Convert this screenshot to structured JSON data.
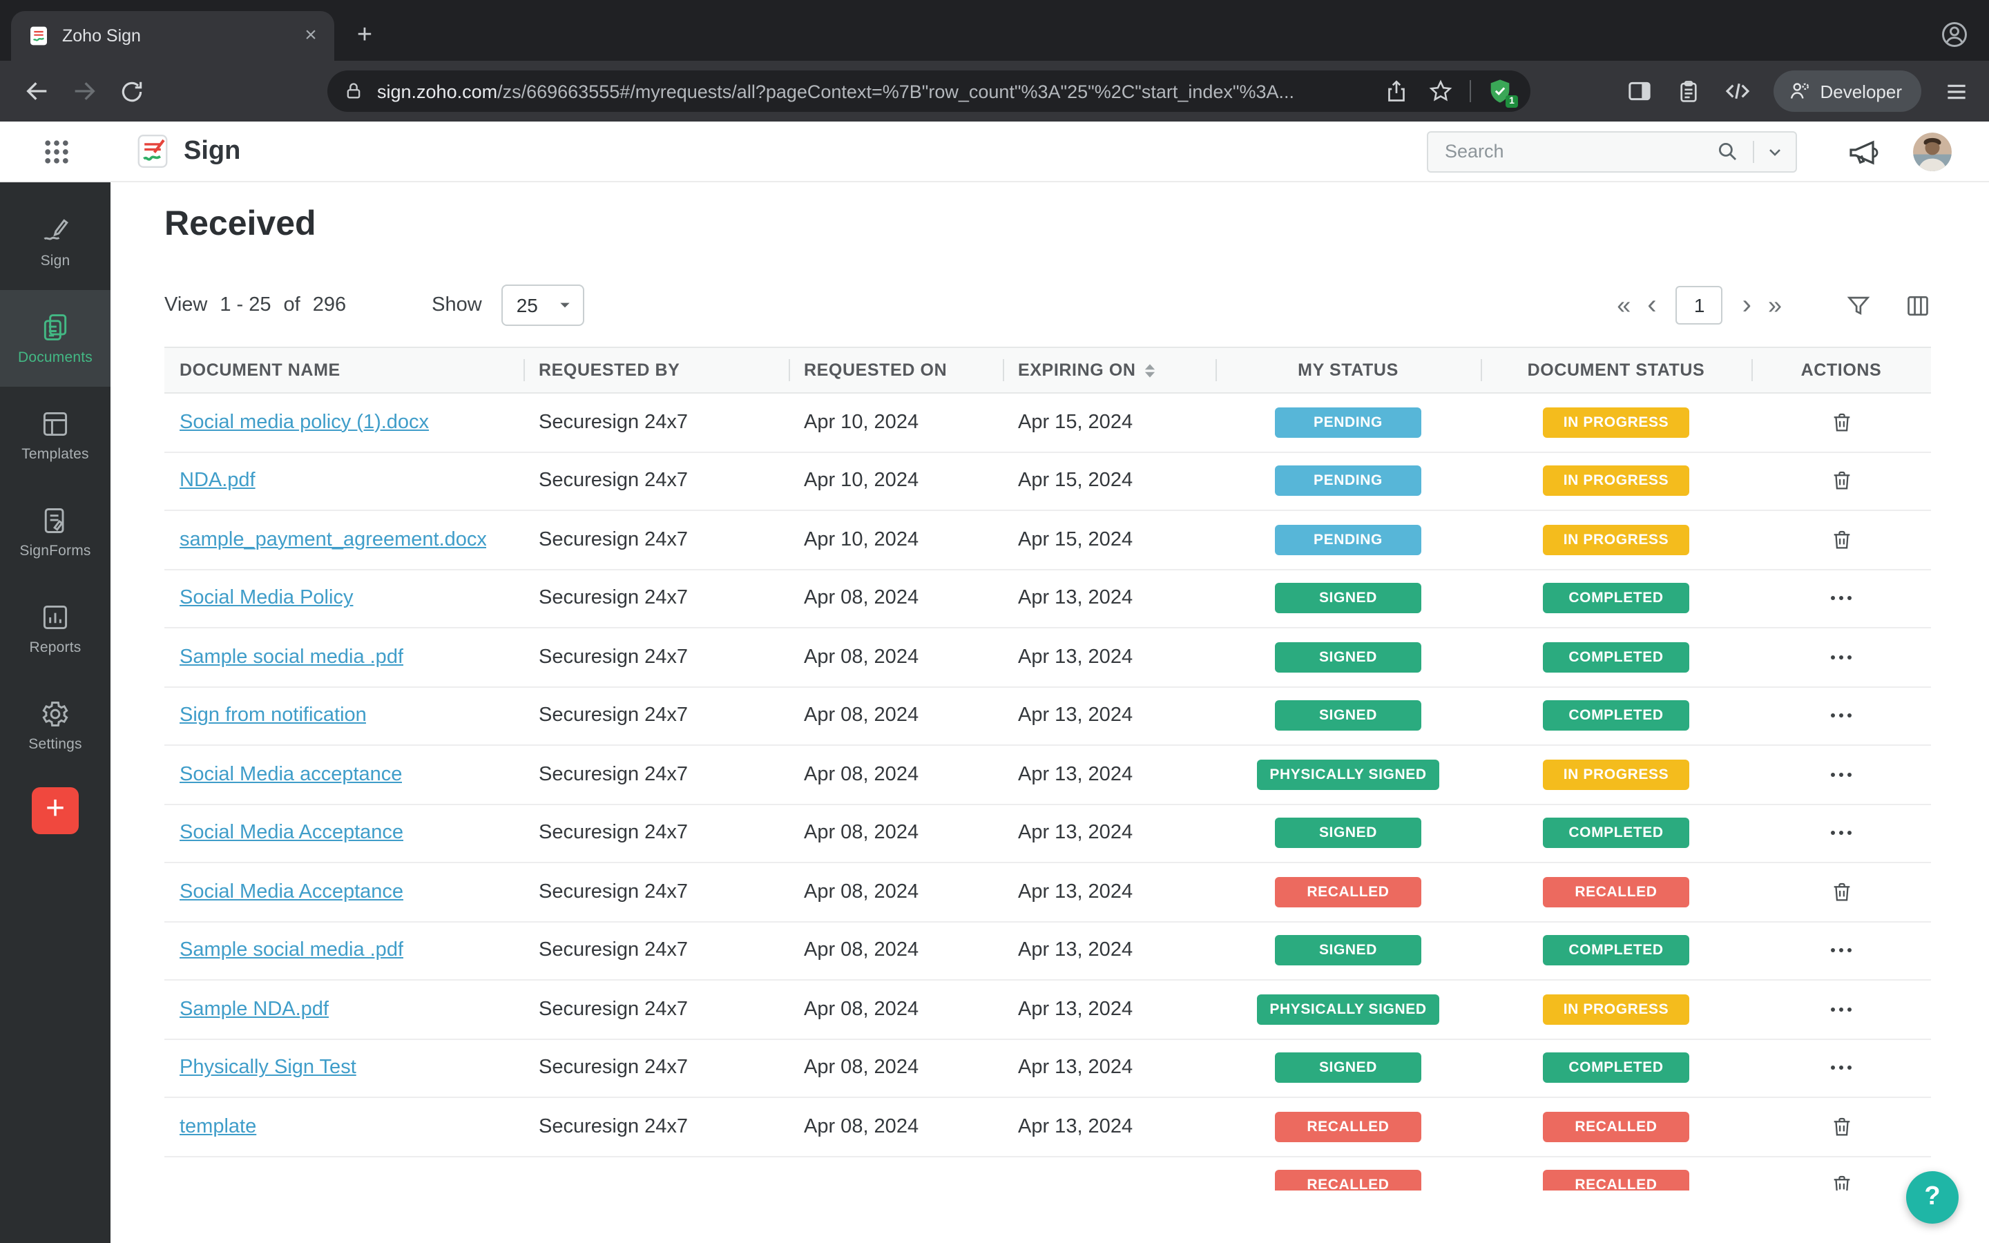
{
  "browser": {
    "tab_title": "Zoho Sign",
    "url_domain": "sign.zoho.com",
    "url_path": "/zs/669663555#/myrequests/all?pageContext=%7B\"row_count\"%3A\"25\"%2C\"start_index\"%3A...",
    "shield_count": "1",
    "developer_label": "Developer"
  },
  "icons": {
    "close": "×",
    "plus": "+",
    "help": "?",
    "pager_first": "«",
    "pager_prev": "‹",
    "pager_next": "›",
    "pager_last": "»"
  },
  "app_header": {
    "product_name": "Sign",
    "search_placeholder": "Search"
  },
  "sidebar": {
    "items": [
      {
        "label": "Sign"
      },
      {
        "label": "Documents"
      },
      {
        "label": "Templates"
      },
      {
        "label": "SignForms"
      },
      {
        "label": "Reports"
      },
      {
        "label": "Settings"
      }
    ]
  },
  "page": {
    "title": "Received",
    "view_label": "View",
    "view_range": "1 - 25",
    "view_of": "of",
    "view_total": "296",
    "show_label": "Show",
    "show_value": "25",
    "page_number": "1"
  },
  "table": {
    "columns": [
      "DOCUMENT NAME",
      "REQUESTED BY",
      "REQUESTED ON",
      "EXPIRING ON",
      "MY STATUS",
      "DOCUMENT STATUS",
      "ACTIONS"
    ],
    "status_colors": {
      "PENDING": "#57B6D8",
      "SIGNED": "#2BAB7F",
      "PHYSICALLY SIGNED": "#2BAB7F",
      "RECALLED": "#EC6A5F",
      "IN PROGRESS": "#F4BC1D",
      "COMPLETED": "#2BAB7F"
    },
    "rows": [
      {
        "name": "Social media policy (1).docx",
        "requested_by": "Securesign 24x7",
        "requested_on": "Apr 10, 2024",
        "expiring_on": "Apr 15, 2024",
        "my_status": "PENDING",
        "doc_status": "IN PROGRESS",
        "action": "trash"
      },
      {
        "name": "NDA.pdf",
        "requested_by": "Securesign 24x7",
        "requested_on": "Apr 10, 2024",
        "expiring_on": "Apr 15, 2024",
        "my_status": "PENDING",
        "doc_status": "IN PROGRESS",
        "action": "trash"
      },
      {
        "name": "sample_payment_agreement.docx",
        "requested_by": "Securesign 24x7",
        "requested_on": "Apr 10, 2024",
        "expiring_on": "Apr 15, 2024",
        "my_status": "PENDING",
        "doc_status": "IN PROGRESS",
        "action": "trash"
      },
      {
        "name": "Social Media Policy",
        "requested_by": "Securesign 24x7",
        "requested_on": "Apr 08, 2024",
        "expiring_on": "Apr 13, 2024",
        "my_status": "SIGNED",
        "doc_status": "COMPLETED",
        "action": "dots"
      },
      {
        "name": "Sample social media .pdf",
        "requested_by": "Securesign 24x7",
        "requested_on": "Apr 08, 2024",
        "expiring_on": "Apr 13, 2024",
        "my_status": "SIGNED",
        "doc_status": "COMPLETED",
        "action": "dots"
      },
      {
        "name": "Sign from notification",
        "requested_by": "Securesign 24x7",
        "requested_on": "Apr 08, 2024",
        "expiring_on": "Apr 13, 2024",
        "my_status": "SIGNED",
        "doc_status": "COMPLETED",
        "action": "dots"
      },
      {
        "name": "Social Media acceptance",
        "requested_by": "Securesign 24x7",
        "requested_on": "Apr 08, 2024",
        "expiring_on": "Apr 13, 2024",
        "my_status": "PHYSICALLY SIGNED",
        "doc_status": "IN PROGRESS",
        "action": "dots"
      },
      {
        "name": "Social Media Acceptance",
        "requested_by": "Securesign 24x7",
        "requested_on": "Apr 08, 2024",
        "expiring_on": "Apr 13, 2024",
        "my_status": "SIGNED",
        "doc_status": "COMPLETED",
        "action": "dots"
      },
      {
        "name": "Social Media Acceptance",
        "requested_by": "Securesign 24x7",
        "requested_on": "Apr 08, 2024",
        "expiring_on": "Apr 13, 2024",
        "my_status": "RECALLED",
        "doc_status": "RECALLED",
        "action": "trash"
      },
      {
        "name": "Sample social media .pdf",
        "requested_by": "Securesign 24x7",
        "requested_on": "Apr 08, 2024",
        "expiring_on": "Apr 13, 2024",
        "my_status": "SIGNED",
        "doc_status": "COMPLETED",
        "action": "dots"
      },
      {
        "name": "Sample NDA.pdf",
        "requested_by": "Securesign 24x7",
        "requested_on": "Apr 08, 2024",
        "expiring_on": "Apr 13, 2024",
        "my_status": "PHYSICALLY SIGNED",
        "doc_status": "IN PROGRESS",
        "action": "dots"
      },
      {
        "name": "Physically Sign Test",
        "requested_by": "Securesign 24x7",
        "requested_on": "Apr 08, 2024",
        "expiring_on": "Apr 13, 2024",
        "my_status": "SIGNED",
        "doc_status": "COMPLETED",
        "action": "dots"
      },
      {
        "name": "template",
        "requested_by": "Securesign 24x7",
        "requested_on": "Apr 08, 2024",
        "expiring_on": "Apr 13, 2024",
        "my_status": "RECALLED",
        "doc_status": "RECALLED",
        "action": "trash"
      },
      {
        "name": "",
        "requested_by": "",
        "requested_on": "",
        "expiring_on": "",
        "my_status": "RECALLED",
        "doc_status": "RECALLED",
        "action": "trash",
        "partial": true
      }
    ]
  }
}
